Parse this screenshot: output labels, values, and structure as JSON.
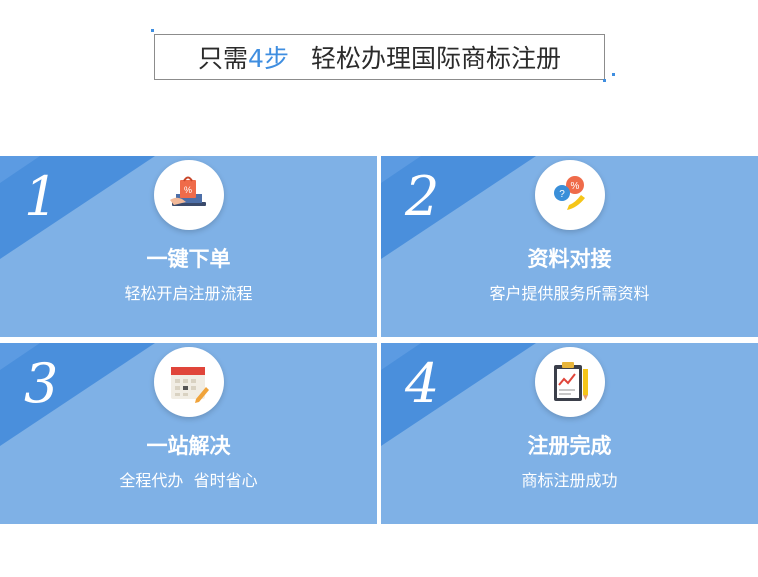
{
  "header": {
    "prefix": "只需",
    "count": "4步",
    "suffix": "轻松办理国际商标注册"
  },
  "steps": [
    {
      "num": "1",
      "title": "一键下单",
      "subtitle": "轻松开启注册流程",
      "icon": "shopping-bag-laptop-icon"
    },
    {
      "num": "2",
      "title": "资料对接",
      "subtitle": "客户提供服务所需资料",
      "icon": "chat-phone-icon"
    },
    {
      "num": "3",
      "title": "一站解决",
      "subtitle": "全程代办  省时省心",
      "icon": "calendar-pencil-icon"
    },
    {
      "num": "4",
      "title": "注册完成",
      "subtitle": "商标注册成功",
      "icon": "clipboard-chart-icon"
    }
  ],
  "colors": {
    "card": "#7fb1e6",
    "band": "#4a8fdc",
    "accent": "#3f8ee0"
  }
}
